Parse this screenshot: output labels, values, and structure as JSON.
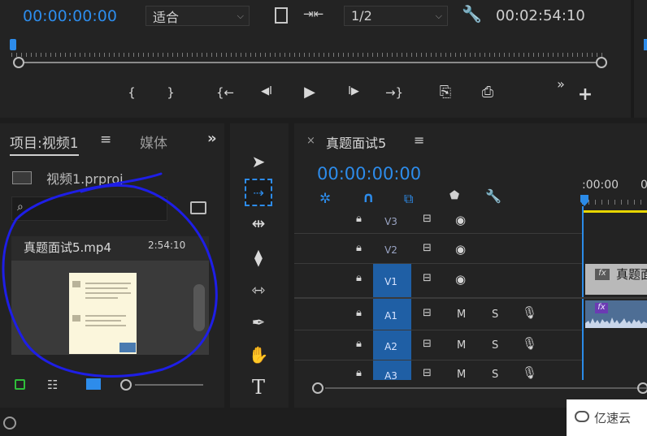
{
  "monitor": {
    "timecode": "00:00:00:00",
    "fit_select": "适合",
    "resolution_select": "1/2",
    "duration": "00:02:54:10",
    "controls": [
      "{",
      "}",
      "{←",
      "◀I",
      "▶",
      "I▶",
      "→}",
      "⎘",
      "⎙"
    ],
    "more": "»",
    "add": "+"
  },
  "project": {
    "tab_project": "项目:视频1",
    "menu": "≡",
    "tab_media": "媒体",
    "overflow": "»",
    "project_file": "视频1.prproj",
    "clip_name": "真题面试5.mp4",
    "clip_duration": "2:54:10"
  },
  "timeline": {
    "close": "×",
    "sequence_name": "真题面试5",
    "menu": "≡",
    "timecode": "00:00:00:00",
    "ruler_label": ":00:00",
    "ruler_label_cut": "0",
    "video_tracks": [
      "V3",
      "V2",
      "V1"
    ],
    "audio_tracks": [
      "A1",
      "A2",
      "A3"
    ],
    "mute": "M",
    "solo": "S",
    "clip_title": "真题面",
    "fx": "fx"
  },
  "watermark": "亿速云",
  "colors": {
    "accent_blue": "#2d8ceb",
    "playhead": "#2b8be8",
    "annotation": "#1e1ee6"
  }
}
